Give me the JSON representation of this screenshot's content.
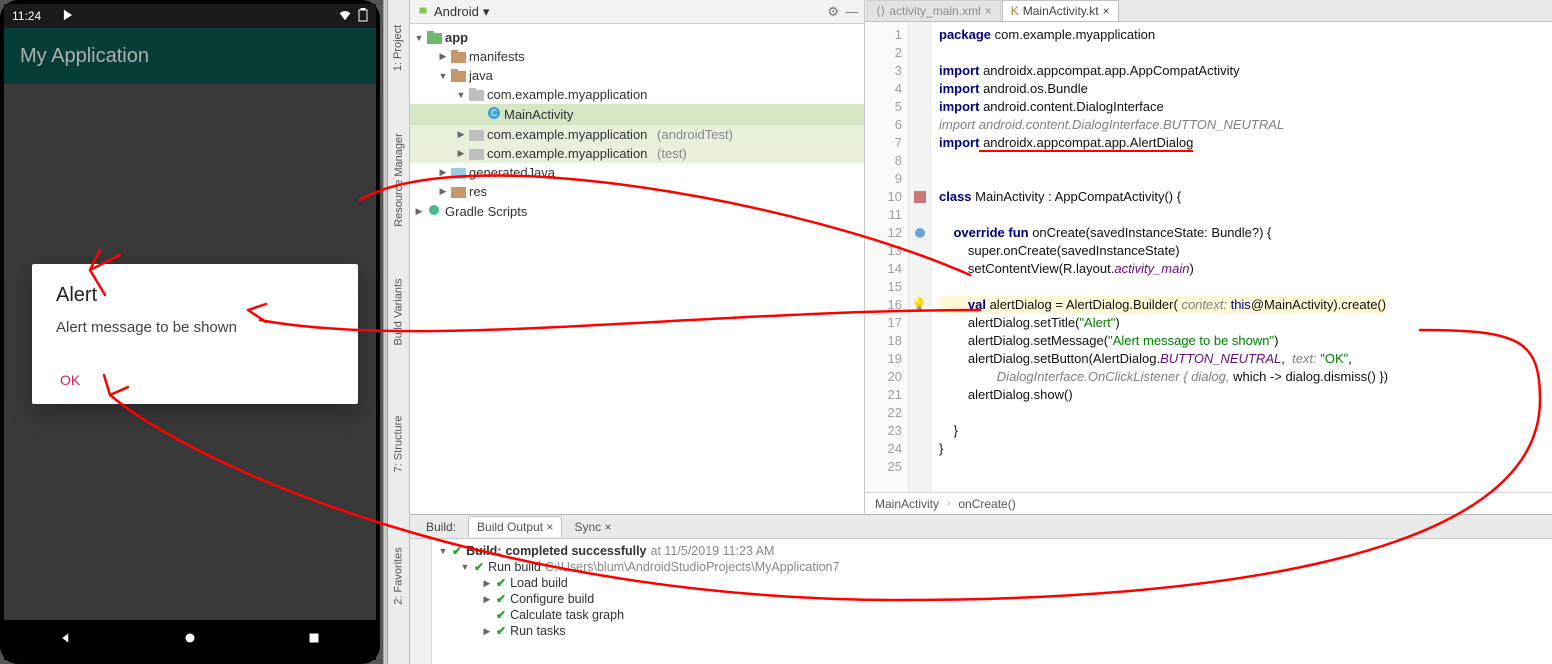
{
  "phone": {
    "time": "11:24",
    "app_title": "My Application",
    "dialog_title": "Alert",
    "dialog_msg": "Alert message to be shown",
    "dialog_btn": "OK"
  },
  "rails": {
    "project": "1: Project",
    "resource": "Resource Manager",
    "build_variants": "Build Variants",
    "structure": "7: Structure",
    "favorites": "2: Favorites"
  },
  "proj_header": {
    "mode": "Android"
  },
  "tree": {
    "app": "app",
    "manifests": "manifests",
    "java": "java",
    "pkg": "com.example.myapplication",
    "main_activity": "MainActivity",
    "pkg_androidTest_suffix": "(androidTest)",
    "pkg_test_suffix": "(test)",
    "generatedJava": "generatedJava",
    "res": "res",
    "gradle_scripts": "Gradle Scripts"
  },
  "tabs": {
    "xml": "activity_main.xml",
    "kt": "MainActivity.kt"
  },
  "code_lines": {
    "1a": "package",
    "1b": " com.example.myapplication",
    "3a": "import",
    "3b": " androidx.appcompat.app.AppCompatActivity",
    "4a": "import",
    "4b": " android.os.Bundle",
    "5a": "import",
    "5b": " android.content.DialogInterface",
    "6a": "import",
    "6b": " android.content.DialogInterface.BUTTON_NEUTRAL",
    "7a": "import",
    "7b": " androidx.appcompat.app.AlertDialog",
    "9a": "class",
    "9b": " MainActivity : AppCompatActivity() {",
    "12a": "    override fun",
    "12b": " onCreate(savedInstanceState: Bundle?) {",
    "13": "        super.onCreate(savedInstanceState)",
    "14a": "        setContentView(R.layout.",
    "14b": "activity_main",
    "14c": ")",
    "16a": "        val",
    "16b": " alertDialog = AlertDialog.Builder(",
    "16c": " context: ",
    "16d": "this",
    "16e": "@MainActivity).create()",
    "17a": "        alertDialog.setTitle(",
    "17b": "\"Alert\"",
    "17c": ")",
    "18a": "        alertDialog.setMessage(",
    "18b": "\"Alert message to be shown\"",
    "18c": ")",
    "19a": "        alertDialog.setButton(AlertDialog.",
    "19b": "BUTTON_NEUTRAL",
    "19c": ",  ",
    "19d": "text: ",
    "19e": "\"OK\"",
    "19f": ",",
    "20a": "                DialogInterface.OnClickListener { dialog, ",
    "20b": "which",
    "20c": " -> dialog.dismiss() })",
    "21": "        alertDialog.show()",
    "23": "    }",
    "24": "}"
  },
  "gutter_lines": [
    "1",
    "2",
    "3",
    "4",
    "5",
    "6",
    "7",
    "8",
    "9",
    "10",
    "11",
    "12",
    "13",
    "14",
    "15",
    "16",
    "17",
    "18",
    "19",
    "20",
    "21",
    "22",
    "23",
    "24",
    "25"
  ],
  "crumbs": {
    "a": "MainActivity",
    "b": "onCreate()"
  },
  "build": {
    "label": "Build:",
    "tab_output": "Build Output",
    "tab_sync": "Sync",
    "l1_a": "Build:",
    "l1_b": " completed successfully",
    "l1_c": " at 11/5/2019 11:23 AM",
    "l2_a": "Run build",
    "l2_b": " C:\\Users\\blum\\AndroidStudioProjects\\MyApplication7",
    "l3": "Load build",
    "l4": "Configure build",
    "l5": "Calculate task graph",
    "l6": "Run tasks"
  }
}
